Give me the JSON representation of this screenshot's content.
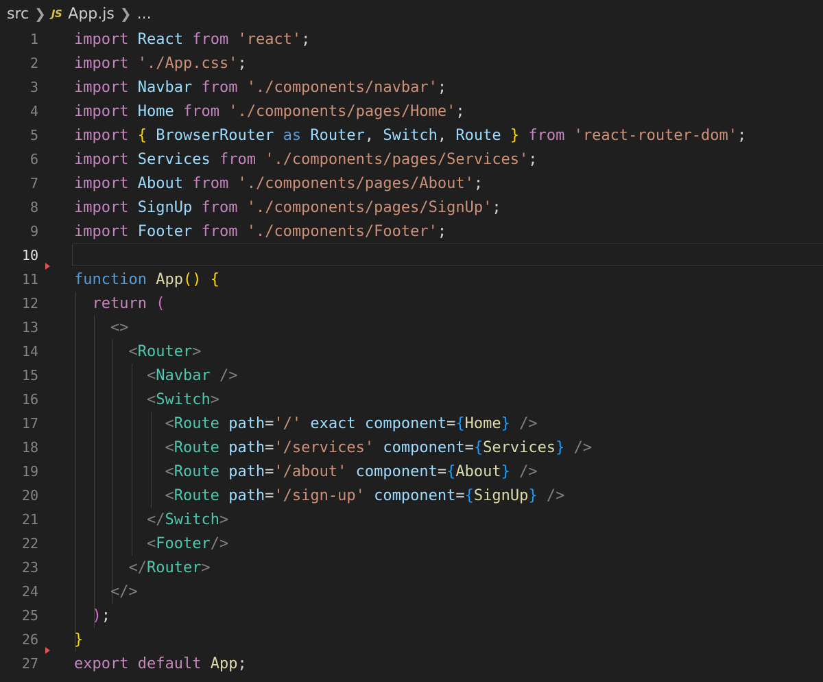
{
  "breadcrumb": {
    "folder": "src",
    "file_icon": "JS",
    "file": "App.js",
    "more": "..."
  },
  "editor": {
    "active_line": 10,
    "line_numbers": [
      "1",
      "2",
      "3",
      "4",
      "5",
      "6",
      "7",
      "8",
      "9",
      "10",
      "11",
      "12",
      "13",
      "14",
      "15",
      "16",
      "17",
      "18",
      "19",
      "20",
      "21",
      "22",
      "23",
      "24",
      "25",
      "26",
      "27"
    ],
    "lines": [
      [
        [
          "kw",
          "import"
        ],
        [
          "pl",
          " "
        ],
        [
          "var",
          "React"
        ],
        [
          "pl",
          " "
        ],
        [
          "kw",
          "from"
        ],
        [
          "pl",
          " "
        ],
        [
          "str",
          "'react'"
        ],
        [
          "pl",
          ";"
        ]
      ],
      [
        [
          "kw",
          "import"
        ],
        [
          "pl",
          " "
        ],
        [
          "str",
          "'./App.css'"
        ],
        [
          "pl",
          ";"
        ]
      ],
      [
        [
          "kw",
          "import"
        ],
        [
          "pl",
          " "
        ],
        [
          "var",
          "Navbar"
        ],
        [
          "pl",
          " "
        ],
        [
          "kw",
          "from"
        ],
        [
          "pl",
          " "
        ],
        [
          "str",
          "'./components/navbar'"
        ],
        [
          "pl",
          ";"
        ]
      ],
      [
        [
          "kw",
          "import"
        ],
        [
          "pl",
          " "
        ],
        [
          "var",
          "Home"
        ],
        [
          "pl",
          " "
        ],
        [
          "kw",
          "from"
        ],
        [
          "pl",
          " "
        ],
        [
          "str",
          "'./components/pages/Home'"
        ],
        [
          "pl",
          ";"
        ]
      ],
      [
        [
          "kw",
          "import"
        ],
        [
          "pl",
          " "
        ],
        [
          "br1",
          "{"
        ],
        [
          "pl",
          " "
        ],
        [
          "var",
          "BrowserRouter"
        ],
        [
          "pl",
          " "
        ],
        [
          "kwb",
          "as"
        ],
        [
          "pl",
          " "
        ],
        [
          "var",
          "Router"
        ],
        [
          "pl",
          ", "
        ],
        [
          "var",
          "Switch"
        ],
        [
          "pl",
          ", "
        ],
        [
          "var",
          "Route"
        ],
        [
          "pl",
          " "
        ],
        [
          "br1",
          "}"
        ],
        [
          "pl",
          " "
        ],
        [
          "kw",
          "from"
        ],
        [
          "pl",
          " "
        ],
        [
          "str",
          "'react-router-dom'"
        ],
        [
          "pl",
          ";"
        ]
      ],
      [
        [
          "kw",
          "import"
        ],
        [
          "pl",
          " "
        ],
        [
          "var",
          "Services"
        ],
        [
          "pl",
          " "
        ],
        [
          "kw",
          "from"
        ],
        [
          "pl",
          " "
        ],
        [
          "str",
          "'./components/pages/Services'"
        ],
        [
          "pl",
          ";"
        ]
      ],
      [
        [
          "kw",
          "import"
        ],
        [
          "pl",
          " "
        ],
        [
          "var",
          "About"
        ],
        [
          "pl",
          " "
        ],
        [
          "kw",
          "from"
        ],
        [
          "pl",
          " "
        ],
        [
          "str",
          "'./components/pages/About'"
        ],
        [
          "pl",
          ";"
        ]
      ],
      [
        [
          "kw",
          "import"
        ],
        [
          "pl",
          " "
        ],
        [
          "var",
          "SignUp"
        ],
        [
          "pl",
          " "
        ],
        [
          "kw",
          "from"
        ],
        [
          "pl",
          " "
        ],
        [
          "str",
          "'./components/pages/SignUp'"
        ],
        [
          "pl",
          ";"
        ]
      ],
      [
        [
          "kw",
          "import"
        ],
        [
          "pl",
          " "
        ],
        [
          "var",
          "Footer"
        ],
        [
          "pl",
          " "
        ],
        [
          "kw",
          "from"
        ],
        [
          "pl",
          " "
        ],
        [
          "str",
          "'./components/Footer'"
        ],
        [
          "pl",
          ";"
        ]
      ],
      [],
      [
        [
          "kwb",
          "function"
        ],
        [
          "pl",
          " "
        ],
        [
          "fn",
          "App"
        ],
        [
          "br1",
          "()"
        ],
        [
          "pl",
          " "
        ],
        [
          "br1",
          "{"
        ]
      ],
      [
        [
          "pl",
          "  "
        ],
        [
          "kw",
          "return"
        ],
        [
          "pl",
          " "
        ],
        [
          "br2",
          "("
        ]
      ],
      [
        [
          "pl",
          "    "
        ],
        [
          "ang",
          "<>"
        ]
      ],
      [
        [
          "pl",
          "      "
        ],
        [
          "ang",
          "<"
        ],
        [
          "tag",
          "Router"
        ],
        [
          "ang",
          ">"
        ]
      ],
      [
        [
          "pl",
          "        "
        ],
        [
          "ang",
          "<"
        ],
        [
          "tag",
          "Navbar"
        ],
        [
          "pl",
          " "
        ],
        [
          "ang",
          "/>"
        ]
      ],
      [
        [
          "pl",
          "        "
        ],
        [
          "ang",
          "<"
        ],
        [
          "tag",
          "Switch"
        ],
        [
          "ang",
          ">"
        ]
      ],
      [
        [
          "pl",
          "          "
        ],
        [
          "ang",
          "<"
        ],
        [
          "tag",
          "Route"
        ],
        [
          "pl",
          " "
        ],
        [
          "attr",
          "path"
        ],
        [
          "pl",
          "="
        ],
        [
          "str",
          "'/'"
        ],
        [
          "pl",
          " "
        ],
        [
          "attr",
          "exact"
        ],
        [
          "pl",
          " "
        ],
        [
          "attr",
          "component"
        ],
        [
          "pl",
          "="
        ],
        [
          "br3",
          "{"
        ],
        [
          "fn",
          "Home"
        ],
        [
          "br3",
          "}"
        ],
        [
          "pl",
          " "
        ],
        [
          "ang",
          "/>"
        ]
      ],
      [
        [
          "pl",
          "          "
        ],
        [
          "ang",
          "<"
        ],
        [
          "tag",
          "Route"
        ],
        [
          "pl",
          " "
        ],
        [
          "attr",
          "path"
        ],
        [
          "pl",
          "="
        ],
        [
          "str",
          "'/services'"
        ],
        [
          "pl",
          " "
        ],
        [
          "attr",
          "component"
        ],
        [
          "pl",
          "="
        ],
        [
          "br3",
          "{"
        ],
        [
          "fn",
          "Services"
        ],
        [
          "br3",
          "}"
        ],
        [
          "pl",
          " "
        ],
        [
          "ang",
          "/>"
        ]
      ],
      [
        [
          "pl",
          "          "
        ],
        [
          "ang",
          "<"
        ],
        [
          "tag",
          "Route"
        ],
        [
          "pl",
          " "
        ],
        [
          "attr",
          "path"
        ],
        [
          "pl",
          "="
        ],
        [
          "str",
          "'/about'"
        ],
        [
          "pl",
          " "
        ],
        [
          "attr",
          "component"
        ],
        [
          "pl",
          "="
        ],
        [
          "br3",
          "{"
        ],
        [
          "fn",
          "About"
        ],
        [
          "br3",
          "}"
        ],
        [
          "pl",
          " "
        ],
        [
          "ang",
          "/>"
        ]
      ],
      [
        [
          "pl",
          "          "
        ],
        [
          "ang",
          "<"
        ],
        [
          "tag",
          "Route"
        ],
        [
          "pl",
          " "
        ],
        [
          "attr",
          "path"
        ],
        [
          "pl",
          "="
        ],
        [
          "str",
          "'/sign-up'"
        ],
        [
          "pl",
          " "
        ],
        [
          "attr",
          "component"
        ],
        [
          "pl",
          "="
        ],
        [
          "br3",
          "{"
        ],
        [
          "fn",
          "SignUp"
        ],
        [
          "br3",
          "}"
        ],
        [
          "pl",
          " "
        ],
        [
          "ang",
          "/>"
        ]
      ],
      [
        [
          "pl",
          "        "
        ],
        [
          "ang",
          "</"
        ],
        [
          "tag",
          "Switch"
        ],
        [
          "ang",
          ">"
        ]
      ],
      [
        [
          "pl",
          "        "
        ],
        [
          "ang",
          "<"
        ],
        [
          "tag",
          "Footer"
        ],
        [
          "ang",
          "/>"
        ]
      ],
      [
        [
          "pl",
          "      "
        ],
        [
          "ang",
          "</"
        ],
        [
          "tag",
          "Router"
        ],
        [
          "ang",
          ">"
        ]
      ],
      [
        [
          "pl",
          "    "
        ],
        [
          "ang",
          "</>"
        ]
      ],
      [
        [
          "pl",
          "  "
        ],
        [
          "br2",
          ")"
        ],
        [
          "pl",
          ";"
        ]
      ],
      [
        [
          "br1",
          "}"
        ]
      ],
      [
        [
          "kw",
          "export"
        ],
        [
          "pl",
          " "
        ],
        [
          "kw",
          "default"
        ],
        [
          "pl",
          " "
        ],
        [
          "fn",
          "App"
        ],
        [
          "pl",
          ";"
        ]
      ]
    ]
  },
  "colors": {
    "background": "#1f1f1f",
    "keyword": "#c586c0",
    "storage": "#569cd6",
    "variable": "#9cdcfe",
    "string": "#ce9178",
    "function": "#dcdcaa",
    "tag": "#4ec9b0",
    "bracket_gold": "#ffd700",
    "bracket_pink": "#da70d6",
    "bracket_blue": "#179fff",
    "fold_marker": "#e05252"
  }
}
